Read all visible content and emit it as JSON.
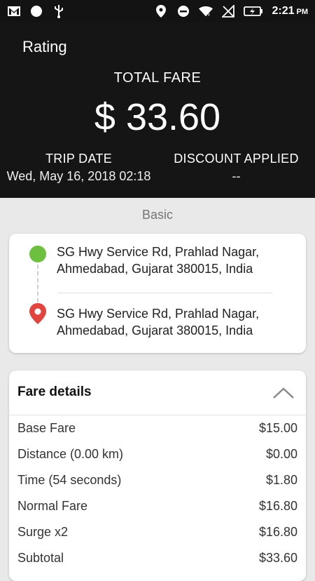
{
  "status_bar": {
    "time": "2:21",
    "ampm": "PM"
  },
  "header": {
    "rating_label": "Rating",
    "total_label": "TOTAL FARE",
    "total_amount": "$ 33.60",
    "trip_date_label": "TRIP DATE",
    "trip_date_value": "Wed, May 16, 2018 02:18",
    "discount_label": "DISCOUNT APPLIED",
    "discount_value": "--"
  },
  "category": "Basic",
  "route": {
    "pickup_line1": "SG Hwy Service Rd, Prahlad Nagar,",
    "pickup_line2": "Ahmedabad, Gujarat 380015, India",
    "drop_line1": "SG Hwy Service Rd, Prahlad Nagar,",
    "drop_line2": "Ahmedabad, Gujarat 380015, India"
  },
  "fare": {
    "title": "Fare details",
    "rows": [
      {
        "label": "Base Fare",
        "value": "$15.00"
      },
      {
        "label": "Distance (0.00 km)",
        "value": "$0.00"
      },
      {
        "label": "Time (54 seconds)",
        "value": "$1.80"
      },
      {
        "label": "Normal Fare",
        "value": "$16.80"
      },
      {
        "label": "Surge x2",
        "value": "$16.80"
      },
      {
        "label": "Subtotal",
        "value": "$33.60"
      }
    ]
  },
  "colors": {
    "header_bg": "#151515",
    "pickup_green": "#6cbf3f",
    "drop_red": "#e0463f"
  }
}
